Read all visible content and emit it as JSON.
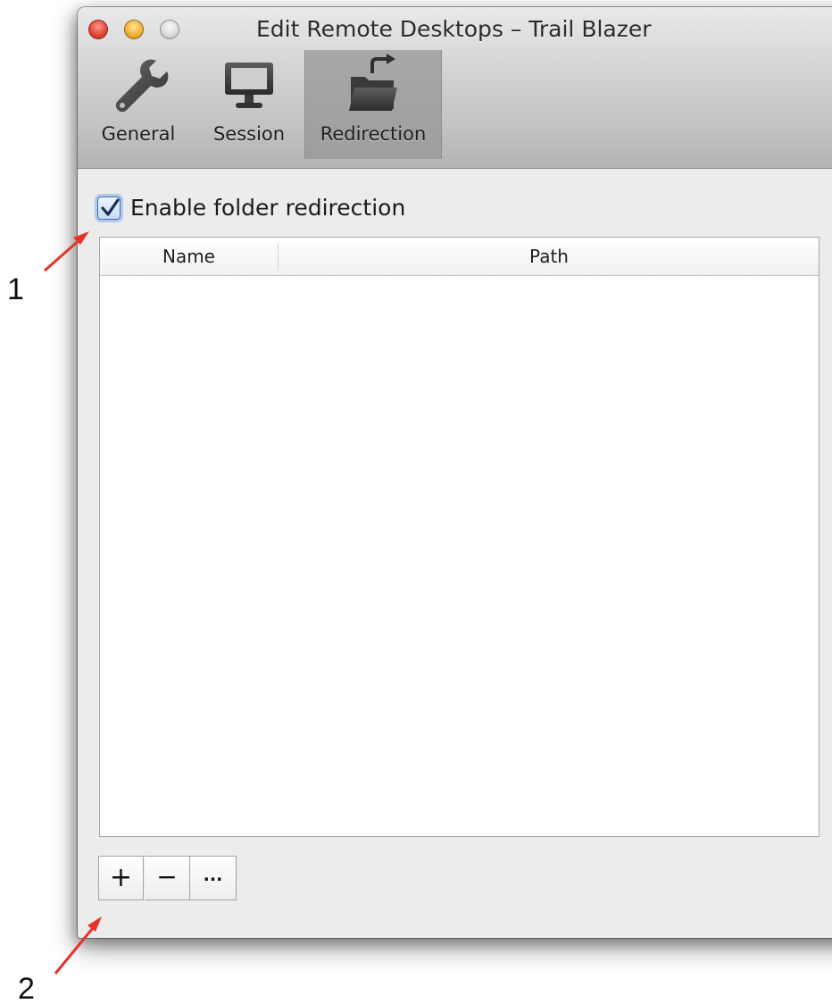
{
  "window": {
    "title": "Edit Remote Desktops – Trail Blazer"
  },
  "toolbar": {
    "tabs": [
      {
        "label": "General",
        "icon": "wrench-icon",
        "selected": false
      },
      {
        "label": "Session",
        "icon": "monitor-icon",
        "selected": false
      },
      {
        "label": "Redirection",
        "icon": "folder-redirect-icon",
        "selected": true
      }
    ]
  },
  "redirection": {
    "enable_label": "Enable folder redirection",
    "enabled": true,
    "table": {
      "columns": [
        "Name",
        "Path"
      ],
      "rows": []
    },
    "buttons": {
      "add": "+",
      "remove": "−",
      "more": "..."
    }
  },
  "annotations": {
    "marker_1": "1",
    "marker_2": "2",
    "arrow_color": "#e8332a"
  },
  "colors": {
    "close": "#e5483c",
    "minimize": "#f3b43c",
    "zoom": "#d9d9d9",
    "checkbox_focus": "#3d6fb3"
  }
}
